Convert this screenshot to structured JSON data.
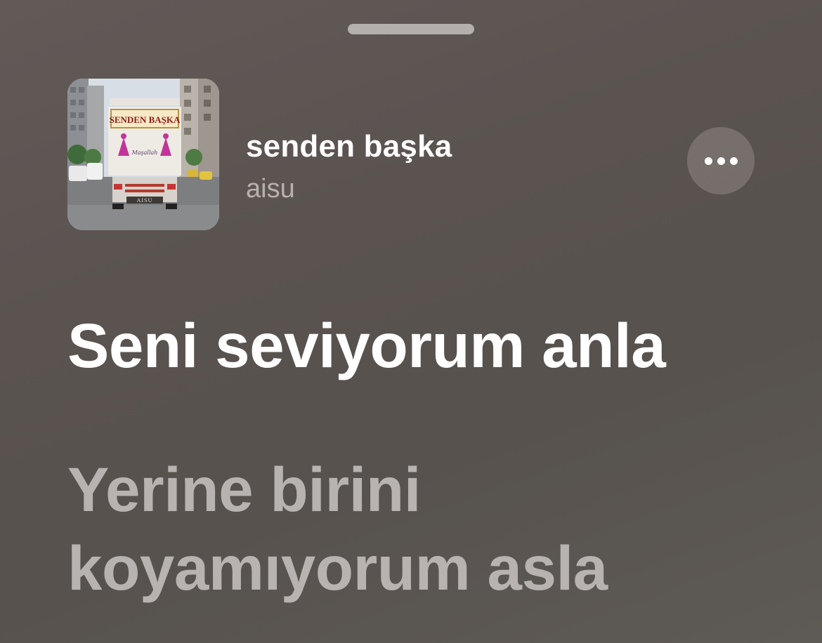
{
  "player": {
    "song_title": "senden başka",
    "artist": "aisu",
    "more_icon": "ellipsis-icon",
    "artwork": {
      "sign_text": "SENDEN BAŞKA",
      "script_text": "Maşallah",
      "plate_text": "AISU"
    }
  },
  "lyrics": {
    "current_line": "Seni seviyorum anla",
    "next_lines": [
      "Yerine birini",
      "koyamıyorum asla"
    ]
  },
  "colors": {
    "background": "#5c5552",
    "active_lyric": "#ffffff",
    "inactive_lyric": "#c8c2c0"
  }
}
